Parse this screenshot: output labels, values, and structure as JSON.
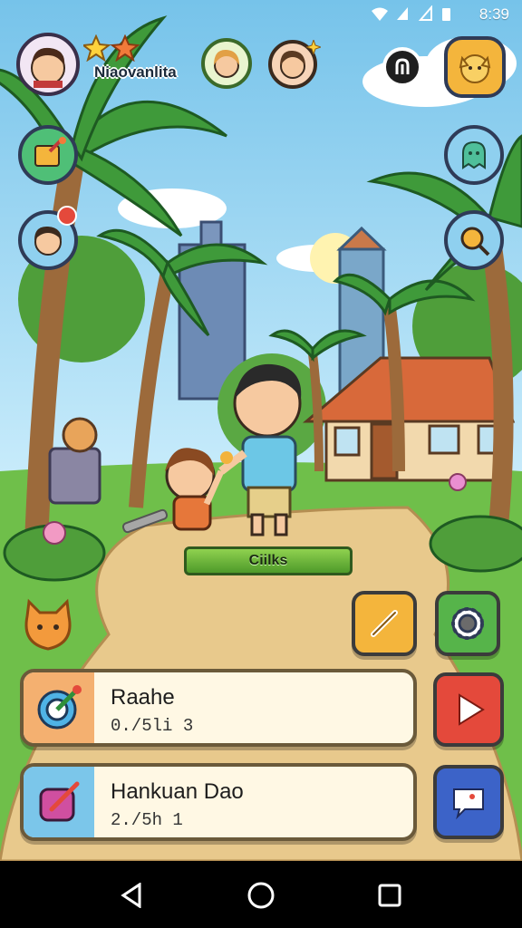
{
  "status_bar": {
    "time": "8:39"
  },
  "player": {
    "name": "Niaovanlita"
  },
  "scene": {
    "action_button": "Ciilks"
  },
  "cards": [
    {
      "title": "Raahe",
      "subtitle": "0./5li 3"
    },
    {
      "title": "Hankuan Dao",
      "subtitle": "2./5h 1"
    }
  ],
  "icons": {
    "profile": "avatar",
    "friend_1": "friend-avatar",
    "friend_2": "friend-avatar",
    "quest": "quest-board-icon",
    "character": "character-avatar",
    "connection": "link-icon",
    "pet": "pet-icon",
    "ghost": "ghost-icon",
    "search": "search-icon",
    "edit": "pencil-icon",
    "settings": "gear-icon",
    "play": "play-icon",
    "chat": "chat-icon"
  },
  "colors": {
    "sky": "#8fd0ef",
    "grass": "#6fbf4a",
    "path": "#e8c98c",
    "play_button": "#e4493b",
    "chat_button": "#3c63c8",
    "edit_button": "#f4b53c",
    "settings_button": "#56b44a"
  }
}
